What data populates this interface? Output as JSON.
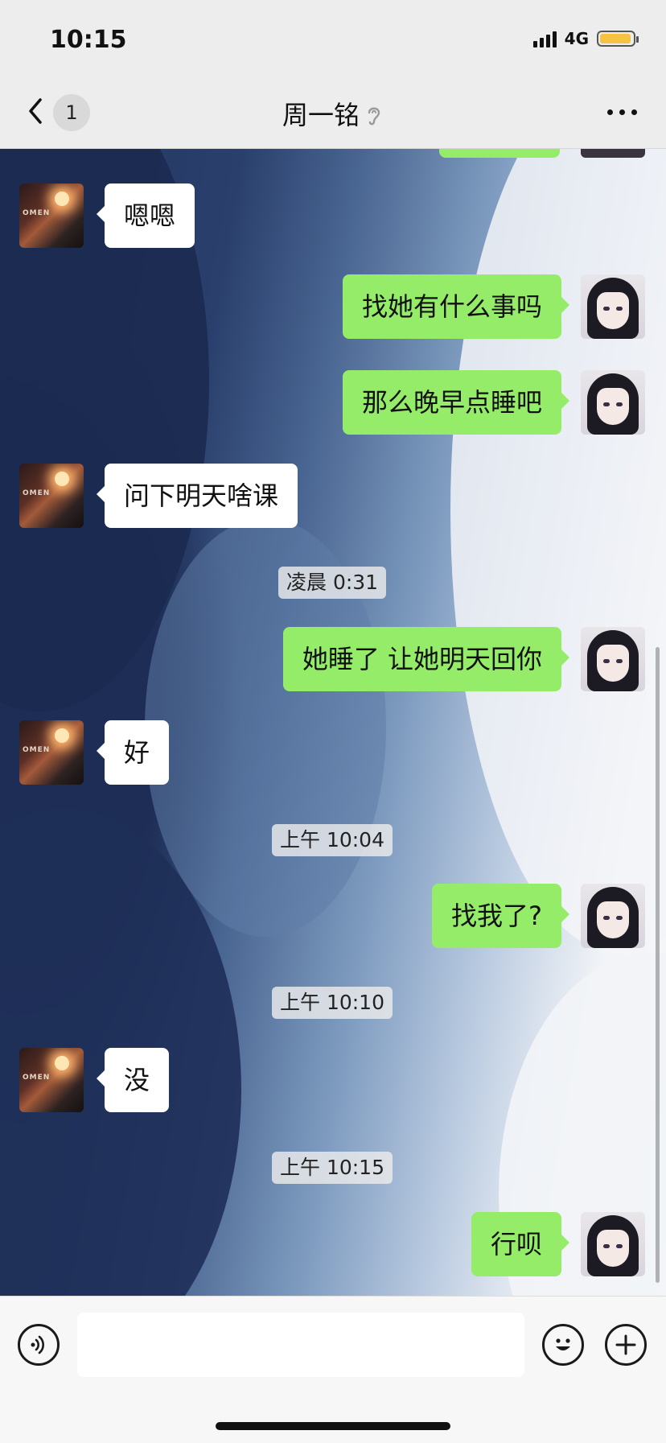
{
  "status_bar": {
    "time": "10:15",
    "network": "4G"
  },
  "nav": {
    "unread_count": "1",
    "title": "周一铭"
  },
  "messages": [
    {
      "from": "other",
      "text": "嗯嗯"
    },
    {
      "from": "self",
      "text": "找她有什么事吗"
    },
    {
      "from": "self",
      "text": "那么晚早点睡吧"
    },
    {
      "from": "other",
      "text": "问下明天啥课"
    },
    {
      "type": "time",
      "text": "凌晨 0:31"
    },
    {
      "from": "self",
      "text": "她睡了 让她明天回你"
    },
    {
      "from": "other",
      "text": "好"
    },
    {
      "type": "time",
      "text": "上午 10:04"
    },
    {
      "from": "self",
      "text": "找我了?"
    },
    {
      "type": "time",
      "text": "上午 10:10"
    },
    {
      "from": "other",
      "text": "没"
    },
    {
      "type": "time",
      "text": "上午 10:15"
    },
    {
      "from": "self",
      "text": "行呗"
    }
  ],
  "avatars": {
    "other_text": "OMEN"
  },
  "icons": {
    "back": "chevron-left-icon",
    "voice_mode": "ear-icon",
    "more": "more-icon",
    "voice_input": "voice-icon",
    "emoji": "emoji-icon",
    "add": "plus-icon"
  },
  "colors": {
    "self_bubble": "#95ec69",
    "other_bubble": "#ffffff",
    "battery": "#f6c244"
  }
}
